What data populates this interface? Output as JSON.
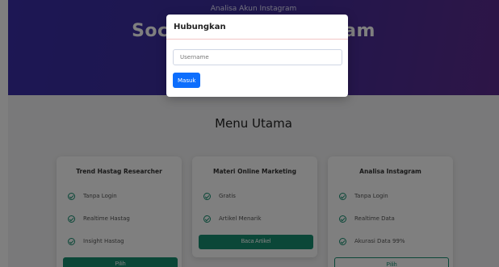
{
  "hero": {
    "subtitle": "Analisa Akun Instagram",
    "title": "Social Media Instagram"
  },
  "section": {
    "title": "Menu Utama"
  },
  "cards": [
    {
      "title": "Trend Hastag Researcher",
      "items": [
        "Tanpa Login",
        "Realtime Hastag",
        "Insight Hastag"
      ],
      "button": "Pilih"
    },
    {
      "title": "Materi Online Marketing",
      "items": [
        "Gratis",
        "Artikel Menarik"
      ],
      "button": "Baca Artikel"
    },
    {
      "title": "Analisa Instagram",
      "items": [
        "Tanpa Login",
        "Realtime Data",
        "Akurasi Data 99%"
      ],
      "button": "Pilih"
    }
  ],
  "modal": {
    "title": "Hubungkan",
    "username_placeholder": "Username",
    "submit": "Masuk"
  },
  "colors": {
    "accent_green": "#168f70",
    "primary_blue": "#0d6efd",
    "hero_start": "#3a2fa8",
    "hero_end": "#5b2b8e"
  }
}
